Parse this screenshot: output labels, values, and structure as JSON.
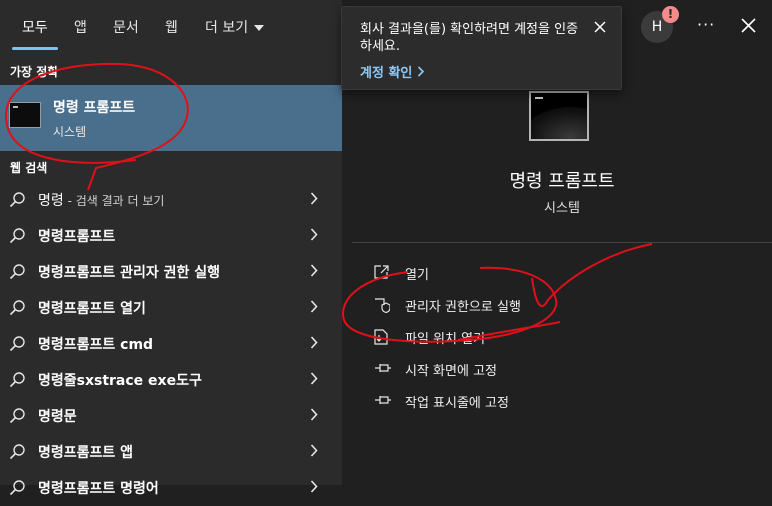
{
  "tabs": [
    {
      "label": "모두"
    },
    {
      "label": "앱"
    },
    {
      "label": "문서"
    },
    {
      "label": "웹"
    },
    {
      "label": "더 보기"
    }
  ],
  "best_match": {
    "heading": "가장 정확",
    "title": "명령 프롬프트",
    "subtitle": "시스템"
  },
  "web_search": {
    "heading": "웹 검색",
    "results": [
      {
        "text": "명령",
        "suffix": " - 검색 결과 더 보기",
        "bold": false
      },
      {
        "text": "명령프롬프트",
        "suffix": "",
        "bold": true
      },
      {
        "text": "명령프롬프트 관리자 권한 실행",
        "suffix": "",
        "bold": true
      },
      {
        "text": "명령프롬프트 열기",
        "suffix": "",
        "bold": true
      },
      {
        "text": "명령프롬프트 cmd",
        "suffix": "",
        "bold": true
      },
      {
        "text": "명령줄sxstrace exe도구",
        "suffix": "",
        "bold": true
      },
      {
        "text": "명령문",
        "suffix": "",
        "bold": true
      },
      {
        "text": "명령프롬프트 앱",
        "suffix": "",
        "bold": true
      },
      {
        "text": "명령프롬프트 명령어",
        "suffix": "",
        "bold": true
      }
    ]
  },
  "preview": {
    "title": "명령 프롬프트",
    "subtitle": "시스템",
    "actions": [
      {
        "label": "열기",
        "icon": "open-icon"
      },
      {
        "label": "관리자 권한으로 실행",
        "icon": "shield-icon"
      },
      {
        "label": "파일 위치 열기",
        "icon": "file-location-icon"
      },
      {
        "label": "시작 화면에 고정",
        "icon": "pin-icon"
      },
      {
        "label": "작업 표시줄에 고정",
        "icon": "pin-icon"
      }
    ]
  },
  "toast": {
    "message": "회사 결과을(를) 확인하려면 계정을 인증하세요.",
    "link": "계정 확인"
  },
  "header": {
    "avatar_letter": "H",
    "alert_mark": "!",
    "more": "···"
  },
  "colors": {
    "accent": "#7cc3f5",
    "selected_bg": "#4a6f8c",
    "annotation": "#e0101a"
  }
}
